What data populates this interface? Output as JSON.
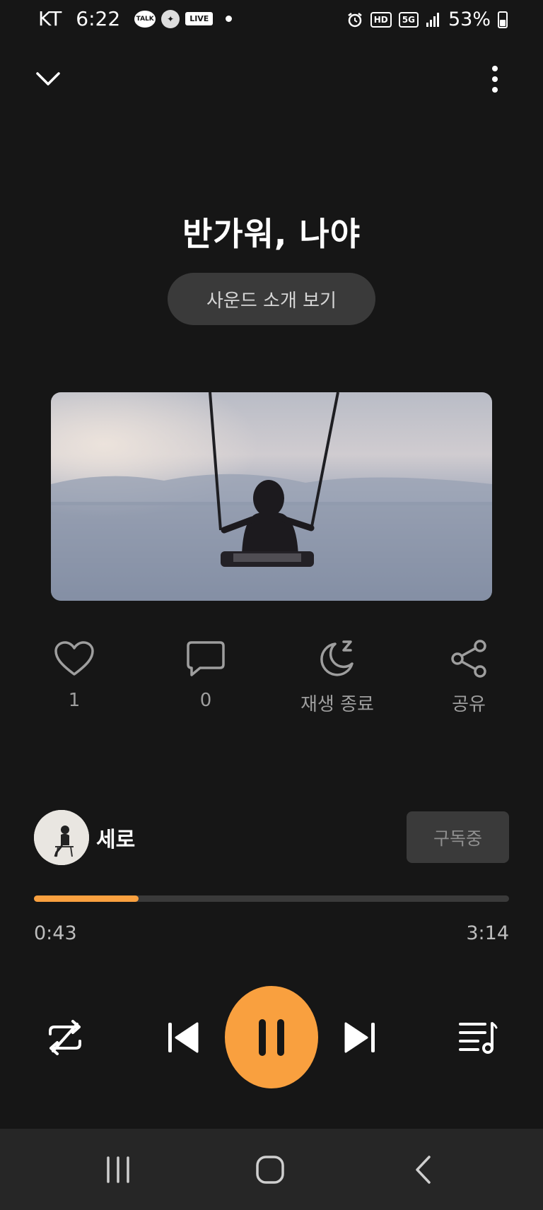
{
  "status_bar": {
    "carrier": "KT",
    "time": "6:22",
    "notifications": {
      "talk": "TALK",
      "live": "LIVE"
    },
    "hd": "HD",
    "network": "5G",
    "battery": "53%"
  },
  "header": {
    "collapse_icon": "chevron-down-icon",
    "more_icon": "more-vertical-icon"
  },
  "track": {
    "title": "반가워, 나야",
    "intro_button": "사운드 소개 보기"
  },
  "actions": [
    {
      "icon": "heart-icon",
      "label": "1"
    },
    {
      "icon": "comment-icon",
      "label": "0"
    },
    {
      "icon": "sleep-timer-icon",
      "label": "재생 종료"
    },
    {
      "icon": "share-icon",
      "label": "공유"
    }
  ],
  "creator": {
    "name": "세로",
    "subscribe_label": "구독중"
  },
  "player": {
    "elapsed": "0:43",
    "total": "3:14",
    "progress_fraction": 0.22
  },
  "colors": {
    "accent": "#f9a03f",
    "background": "#161616",
    "surface": "#3a3a3a",
    "nav_background": "#262626"
  }
}
